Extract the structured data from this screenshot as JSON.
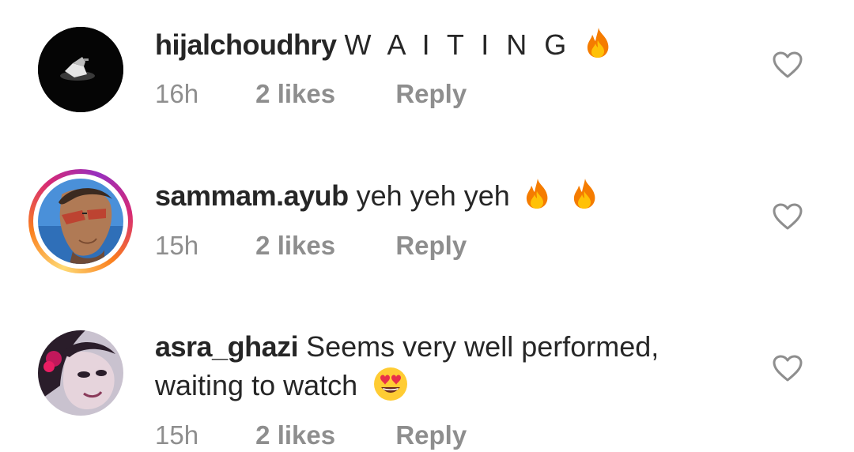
{
  "comments": [
    {
      "username": "hijalchoudhry",
      "text": "W A I T I N G",
      "text_line2": "",
      "emojis": [
        "fire-emoji"
      ],
      "time": "16h",
      "likes": "2 likes",
      "reply": "Reply",
      "avatar_icon": "dark-profile-photo",
      "has_story_ring": false
    },
    {
      "username": "sammam.ayub",
      "text": "yeh yeh yeh",
      "text_line2": "",
      "emojis": [
        "fire-emoji",
        "fire-emoji"
      ],
      "time": "15h",
      "likes": "2 likes",
      "reply": "Reply",
      "avatar_icon": "man-with-sunglasses-photo",
      "has_story_ring": true
    },
    {
      "username": "asra_ghazi",
      "text": "Seems very well performed,",
      "text_line2": "waiting to watch",
      "emojis": [
        "heart-eyes-emoji"
      ],
      "time": "15h",
      "likes": "2 likes",
      "reply": "Reply",
      "avatar_icon": "woman-selfie-photo",
      "has_story_ring": false
    }
  ],
  "like_icon": "heart-outline-icon",
  "colors": {
    "text": "#262626",
    "meta": "#8e8e8e",
    "story_ring": [
      "#feda75",
      "#fa7e1e",
      "#d62976",
      "#962fbf"
    ]
  }
}
